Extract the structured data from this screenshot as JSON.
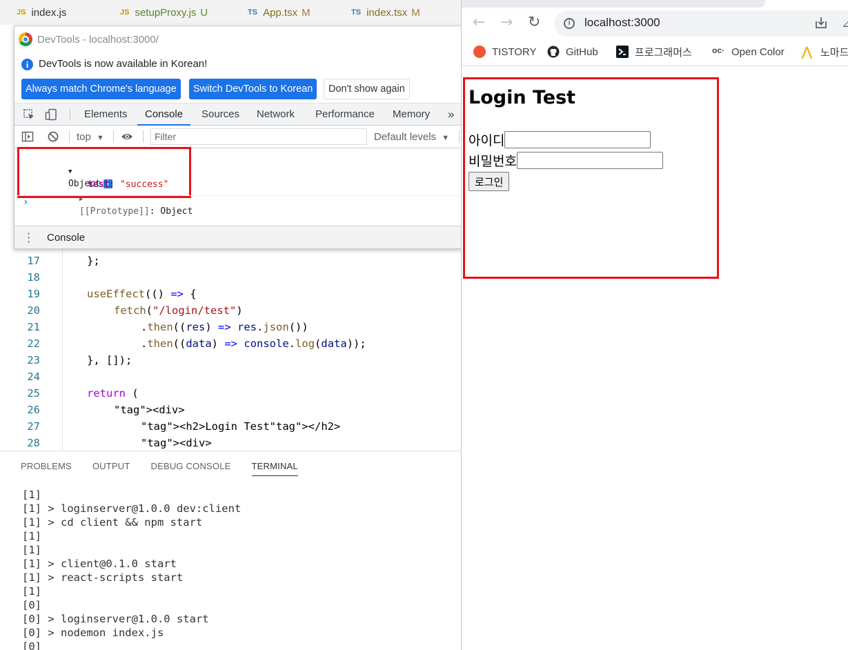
{
  "vscode": {
    "tabs": [
      {
        "type": "JS",
        "name": "index.js",
        "status": ""
      },
      {
        "type": "JS",
        "name": "setupProxy.js",
        "status": "U"
      },
      {
        "type": "TS",
        "name": "App.tsx",
        "status": "M"
      },
      {
        "type": "TS",
        "name": "index.tsx",
        "status": "M"
      }
    ],
    "code": {
      "line_numbers": [
        "17",
        "18",
        "19",
        "20",
        "21",
        "22",
        "23",
        "24",
        "25",
        "26",
        "27",
        "28"
      ],
      "lines": [
        "};",
        "",
        "useEffect(() => {",
        "fetch(\"/login/test\")",
        ".then((res) => res.json())",
        ".then((data) => console.log(data));",
        "}, []);",
        "",
        "return (",
        "<div>",
        "<h2>Login Test</h2>",
        "<div>"
      ]
    },
    "panel": {
      "tabs": [
        "PROBLEMS",
        "OUTPUT",
        "DEBUG CONSOLE",
        "TERMINAL"
      ],
      "active_tab": "TERMINAL",
      "terminal_lines": [
        "[1]",
        "[1] > loginserver@1.0.0 dev:client",
        "[1] > cd client && npm start",
        "[1]",
        "[1]",
        "[1] > client@0.1.0 start",
        "[1] > react-scripts start",
        "[1]",
        "[0]",
        "[0] > loginserver@1.0.0 start",
        "[0] > nodemon index.js",
        "[0]"
      ]
    }
  },
  "devtools": {
    "window_title": "DevTools - localhost:3000/",
    "infobar": {
      "message": "DevTools is now available in Korean!",
      "btn_match": "Always match Chrome's language",
      "btn_switch": "Switch DevTools to Korean",
      "btn_dismiss": "Don't show again"
    },
    "tabs": [
      "Elements",
      "Console",
      "Sources",
      "Network",
      "Performance",
      "Memory"
    ],
    "active_tab": "Console",
    "more_tabs": "»",
    "toolbar": {
      "context": "top",
      "filter_placeholder": "Filter",
      "levels": "Default levels"
    },
    "console": {
      "object_label": "Object",
      "prop_key": "test",
      "prop_value": "\"success\"",
      "proto_key": "[[Prototype]]",
      "proto_value": "Object",
      "prompt": "›"
    },
    "drawer_tab": "Console"
  },
  "browser": {
    "url": "localhost:3000",
    "bookmarks": [
      "TISTORY",
      "GitHub",
      "프로그래머스",
      "Open Color",
      "노마드"
    ],
    "page": {
      "heading": "Login Test",
      "id_label": "아이디",
      "pw_label": "비밀번호",
      "login_button": "로그인"
    }
  },
  "colors": {
    "highlight_box": "#e8101b",
    "chrome_blue": "#1a73e8"
  }
}
